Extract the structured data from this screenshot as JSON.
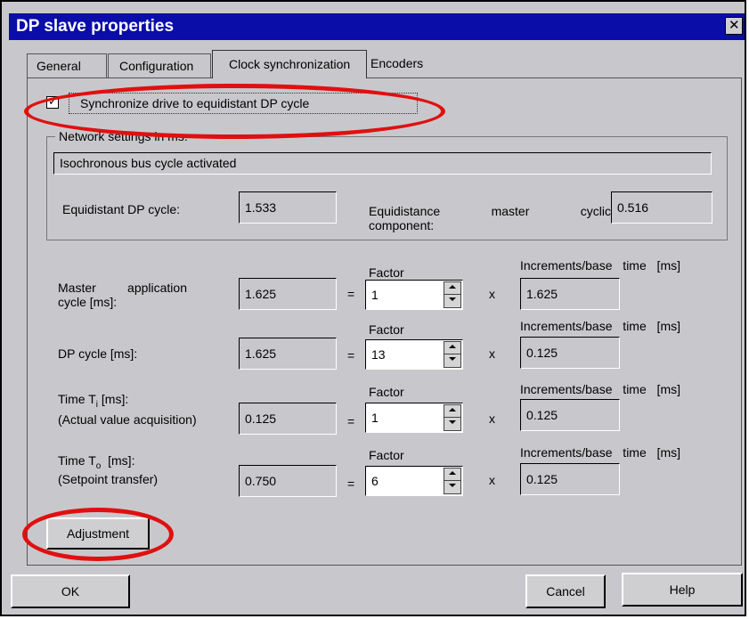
{
  "dialog": {
    "title": "DP slave properties",
    "close_glyph": "✕"
  },
  "tabs": [
    {
      "label": "General"
    },
    {
      "label": "Configuration"
    },
    {
      "label": "Clock synchronization"
    },
    {
      "label": "Encoders"
    }
  ],
  "sync": {
    "checkbox_checked": true,
    "check_glyph": "✓",
    "label": "Synchronize drive to equidistant DP cycle"
  },
  "network": {
    "group_label": "Network settings in ms:",
    "status": "Isochronous bus cycle activated",
    "equidistant_label": "Equidistant DP cycle:",
    "equidistant_value": "1.533",
    "master_label_line1": "Equidistance master cyclic",
    "master_label_line2": "component:",
    "master_value": "0.516"
  },
  "rows": [
    {
      "label1": "Master application",
      "label2": "cycle [ms]:",
      "value": "1.625",
      "eq": "=",
      "factor_label": "Factor",
      "factor": "1",
      "x": "x",
      "inc_label": "Increments/base time [ms]",
      "inc_value": "1.625"
    },
    {
      "label1": "DP cycle [ms]:",
      "label2": "",
      "value": "1.625",
      "eq": "=",
      "factor_label": "Factor",
      "factor": "13",
      "x": "x",
      "inc_label": "Increments/base time [ms]",
      "inc_value": "0.125"
    },
    {
      "label1": "Time Ti [ms]:",
      "label2": "(Actual value acquisition)",
      "value": "0.125",
      "eq": "=",
      "factor_label": "Factor",
      "factor": "1",
      "x": "x",
      "inc_label": "Increments/base time [ms]",
      "inc_value": "0.125"
    },
    {
      "label1": "Time To [ms]:",
      "label2": "(Setpoint transfer)",
      "value": "0.750",
      "eq": "=",
      "factor_label": "Factor",
      "factor": "6",
      "x": "x",
      "inc_label": "Increments/base time [ms]",
      "inc_value": "0.125"
    }
  ],
  "buttons": {
    "adjustment": "Adjustment",
    "ok": "OK",
    "cancel": "Cancel",
    "help": "Help"
  },
  "colors": {
    "title_bar": "#0a0da8",
    "annotation": "#e01010"
  }
}
